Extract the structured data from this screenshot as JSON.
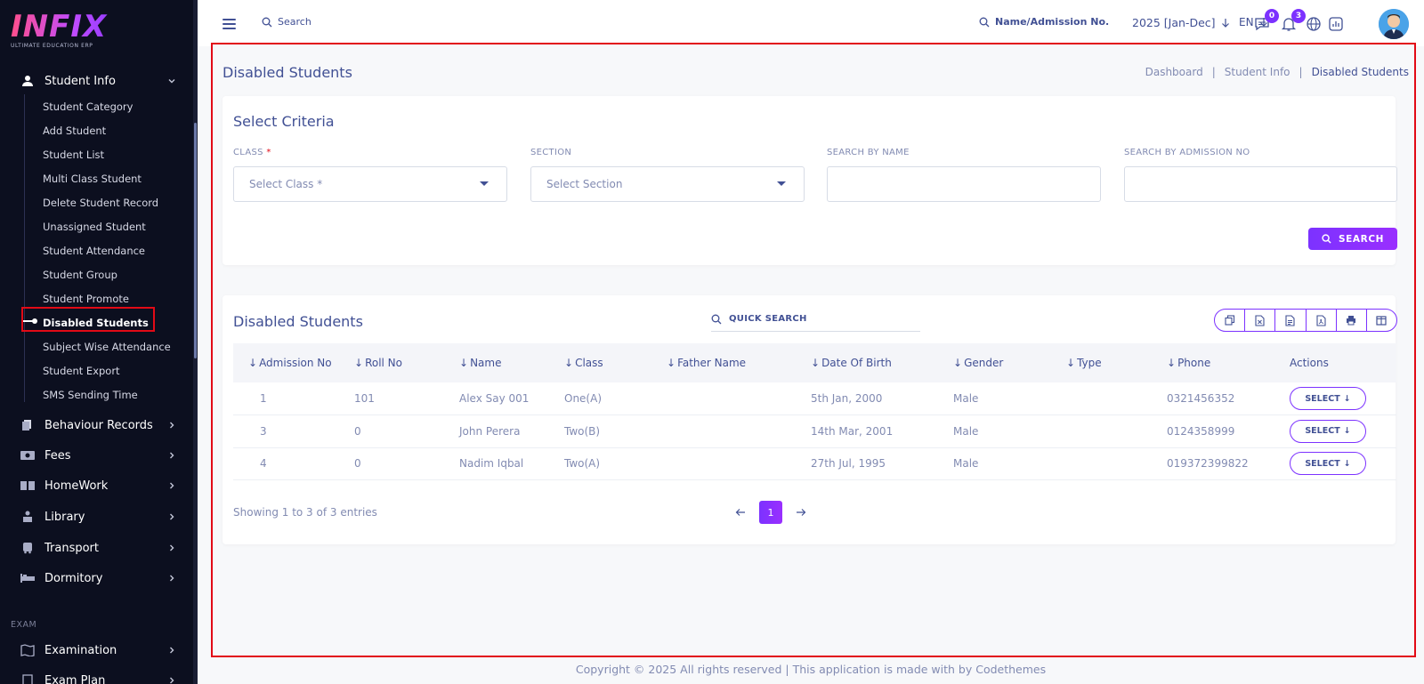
{
  "brand": {
    "name": "INFIX",
    "tagline": "ULTIMATE EDUCATION ERP"
  },
  "sidebar": {
    "groups": [
      {
        "label": "Student Info",
        "icon": "user-icon",
        "expanded": true
      },
      {
        "label": "Behaviour Records",
        "icon": "documents-icon"
      },
      {
        "label": "Fees",
        "icon": "money-icon"
      },
      {
        "label": "HomeWork",
        "icon": "book-icon"
      },
      {
        "label": "Library",
        "icon": "library-icon"
      },
      {
        "label": "Transport",
        "icon": "bus-icon"
      },
      {
        "label": "Dormitory",
        "icon": "bed-icon"
      },
      {
        "label": "Examination",
        "icon": "map-icon"
      },
      {
        "label": "Exam Plan",
        "icon": "plan-icon"
      }
    ],
    "sub_items": [
      "Student Category",
      "Add Student",
      "Student List",
      "Multi Class Student",
      "Delete Student Record",
      "Unassigned Student",
      "Student Attendance",
      "Student Group",
      "Student Promote",
      "Disabled Students",
      "Subject Wise Attendance",
      "Student Export",
      "SMS Sending Time"
    ],
    "active_sub": "Disabled Students",
    "section_exam": "EXAM"
  },
  "topbar": {
    "search_label": "Search",
    "search2_label": "Name/Admission No.",
    "year": "2025 [Jan-Dec]",
    "lang": "EN",
    "chat_count": "0",
    "notif_count": "3"
  },
  "page": {
    "title": "Disabled Students",
    "breadcrumb": [
      "Dashboard",
      "Student Info",
      "Disabled Students"
    ]
  },
  "criteria": {
    "title": "Select Criteria",
    "class_label": "CLASS",
    "class_required": "*",
    "class_placeholder": "Select Class *",
    "section_label": "SECTION",
    "section_placeholder": "Select Section",
    "name_label": "SEARCH BY NAME",
    "name_value": "",
    "admission_label": "SEARCH BY ADMISSION NO",
    "admission_value": "",
    "search_button": "SEARCH"
  },
  "list": {
    "title": "Disabled Students",
    "quick_search": "QUICK SEARCH",
    "columns": [
      "Admission No",
      "Roll No",
      "Name",
      "Class",
      "Father Name",
      "Date Of Birth",
      "Gender",
      "Type",
      "Phone",
      "Actions"
    ],
    "rows": [
      {
        "admission": "1",
        "roll": "101",
        "name": "Alex Say 001",
        "class": "One(A)",
        "father": "",
        "dob": "5th Jan, 2000",
        "gender": "Male",
        "type": "",
        "phone": "0321456352"
      },
      {
        "admission": "3",
        "roll": "0",
        "name": "John Perera",
        "class": "Two(B)",
        "father": "",
        "dob": "14th Mar, 2001",
        "gender": "Male",
        "type": "",
        "phone": "0124358999"
      },
      {
        "admission": "4",
        "roll": "0",
        "name": "Nadim Iqbal",
        "class": "Two(A)",
        "father": "",
        "dob": "27th Jul, 1995",
        "gender": "Male",
        "type": "",
        "phone": "019372399822"
      }
    ],
    "action_label": "SELECT",
    "showing": "Showing 1 to 3 of 3 entries",
    "page": "1"
  },
  "footer": "Copyright © 2025 All rights reserved | This application is made with by Codethemes",
  "colors": {
    "accent": "#7c32ff",
    "text": "#415094",
    "muted": "#828bb2",
    "highlight": "#e20a16",
    "sidebar": "#0c0f1f"
  }
}
